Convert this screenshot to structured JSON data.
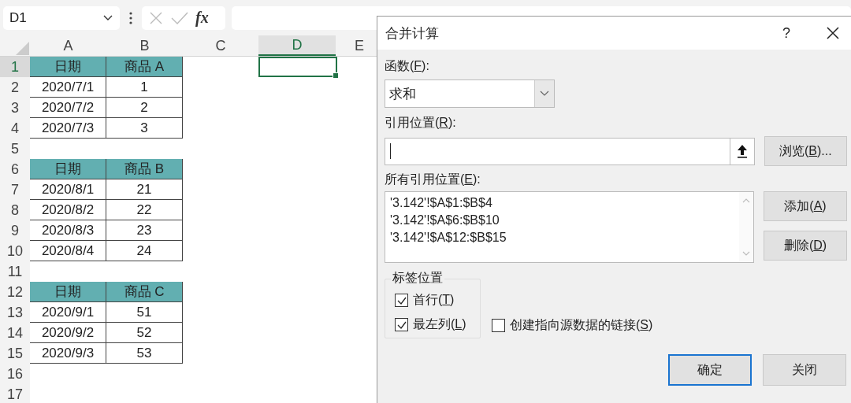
{
  "name_box": {
    "value": "D1"
  },
  "formula_bar": {
    "function_label": "fx"
  },
  "sheet": {
    "columns": [
      {
        "label": "A",
        "selected": false
      },
      {
        "label": "B",
        "selected": false
      },
      {
        "label": "C",
        "selected": false
      },
      {
        "label": "D",
        "selected": true
      },
      {
        "label": "E",
        "selected": false
      }
    ],
    "rows": [
      {
        "number": "1",
        "selected": true,
        "cells": [
          {
            "text": "日期",
            "kind": "header"
          },
          {
            "text": "商品 A",
            "kind": "header"
          }
        ]
      },
      {
        "number": "2",
        "selected": false,
        "cells": [
          {
            "text": "2020/7/1",
            "kind": "data"
          },
          {
            "text": "1",
            "kind": "data"
          }
        ]
      },
      {
        "number": "3",
        "selected": false,
        "cells": [
          {
            "text": "2020/7/2",
            "kind": "data"
          },
          {
            "text": "2",
            "kind": "data"
          }
        ]
      },
      {
        "number": "4",
        "selected": false,
        "cells": [
          {
            "text": "2020/7/3",
            "kind": "data"
          },
          {
            "text": "3",
            "kind": "data"
          }
        ]
      },
      {
        "number": "5",
        "selected": false,
        "cells": []
      },
      {
        "number": "6",
        "selected": false,
        "cells": [
          {
            "text": "日期",
            "kind": "header"
          },
          {
            "text": "商品 B",
            "kind": "header"
          }
        ]
      },
      {
        "number": "7",
        "selected": false,
        "cells": [
          {
            "text": "2020/8/1",
            "kind": "data"
          },
          {
            "text": "21",
            "kind": "data"
          }
        ]
      },
      {
        "number": "8",
        "selected": false,
        "cells": [
          {
            "text": "2020/8/2",
            "kind": "data"
          },
          {
            "text": "22",
            "kind": "data"
          }
        ]
      },
      {
        "number": "9",
        "selected": false,
        "cells": [
          {
            "text": "2020/8/3",
            "kind": "data"
          },
          {
            "text": "23",
            "kind": "data"
          }
        ]
      },
      {
        "number": "10",
        "selected": false,
        "cells": [
          {
            "text": "2020/8/4",
            "kind": "data"
          },
          {
            "text": "24",
            "kind": "data"
          }
        ]
      },
      {
        "number": "11",
        "selected": false,
        "cells": []
      },
      {
        "number": "12",
        "selected": false,
        "cells": [
          {
            "text": "日期",
            "kind": "header"
          },
          {
            "text": "商品 C",
            "kind": "header"
          }
        ]
      },
      {
        "number": "13",
        "selected": false,
        "cells": [
          {
            "text": "2020/9/1",
            "kind": "data"
          },
          {
            "text": "51",
            "kind": "data"
          }
        ]
      },
      {
        "number": "14",
        "selected": false,
        "cells": [
          {
            "text": "2020/9/2",
            "kind": "data"
          },
          {
            "text": "52",
            "kind": "data"
          }
        ]
      },
      {
        "number": "15",
        "selected": false,
        "cells": [
          {
            "text": "2020/9/3",
            "kind": "data"
          },
          {
            "text": "53",
            "kind": "data"
          }
        ]
      },
      {
        "number": "16",
        "selected": false,
        "cells": []
      },
      {
        "number": "17",
        "selected": false,
        "cells": []
      }
    ]
  },
  "dialog": {
    "title": "合并计算",
    "help": "?",
    "function": {
      "label": {
        "before": "函数(",
        "key": "F",
        "after": "):"
      },
      "value": "求和"
    },
    "reference": {
      "label": {
        "before": "引用位置(",
        "key": "R",
        "after": "):"
      }
    },
    "browse_button": {
      "before": "浏览(",
      "key": "B",
      "after": ")..."
    },
    "all_references": {
      "label": {
        "before": "所有引用位置(",
        "key": "E",
        "after": "):"
      },
      "items": [
        "'3.142'!$A$1:$B$4",
        "'3.142'!$A$6:$B$10",
        "'3.142'!$A$12:$B$15"
      ]
    },
    "add_button": {
      "before": "添加(",
      "key": "A",
      "after": ")"
    },
    "delete_button": {
      "before": "删除(",
      "key": "D",
      "after": ")"
    },
    "labels_group": {
      "legend": "标签位置",
      "options": [
        {
          "label": {
            "before": "首行(",
            "key": "T",
            "after": ")"
          },
          "checked": true
        },
        {
          "label": {
            "before": "最左列(",
            "key": "L",
            "after": ")"
          },
          "checked": true
        }
      ]
    },
    "link_option": {
      "label": {
        "before": "创建指向源数据的链接(",
        "key": "S",
        "after": ")"
      },
      "checked": false
    },
    "buttons": [
      {
        "label": "确定",
        "default": true
      },
      {
        "label": "关闭",
        "default": false
      }
    ]
  }
}
